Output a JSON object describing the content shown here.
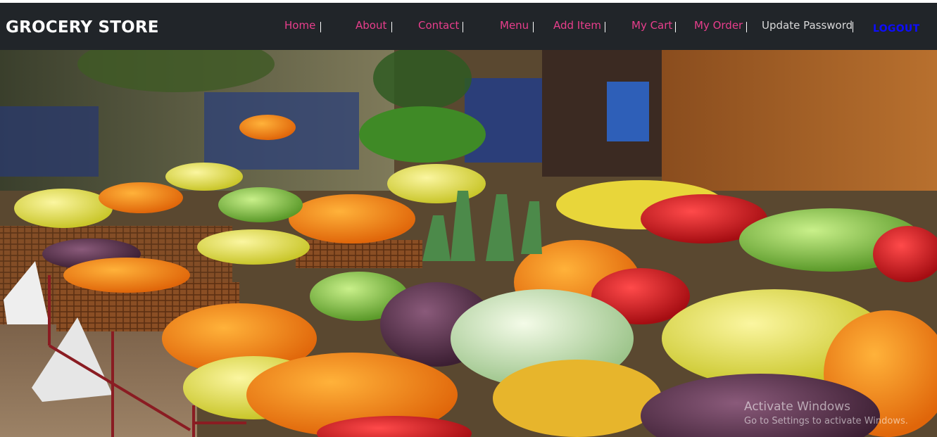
{
  "brand": {
    "title": "GROCERY STORE"
  },
  "nav": {
    "items": [
      {
        "label": "Home"
      },
      {
        "label": "About"
      },
      {
        "label": "Contact"
      },
      {
        "label": "Menu"
      },
      {
        "label": "Add Item"
      },
      {
        "label": "My Cart"
      },
      {
        "label": "My Order"
      },
      {
        "label": "Update Password"
      }
    ],
    "logout": "LOGOUT"
  },
  "hero": {
    "image": "fruit-market-photo"
  },
  "watermark": {
    "title": "Activate Windows",
    "subtitle": "Go to Settings to activate Windows."
  },
  "colors": {
    "navbar_bg": "#212529",
    "nav_link": "#e83e8c",
    "logout": "#0d0dff",
    "brand": "#ffffff"
  }
}
